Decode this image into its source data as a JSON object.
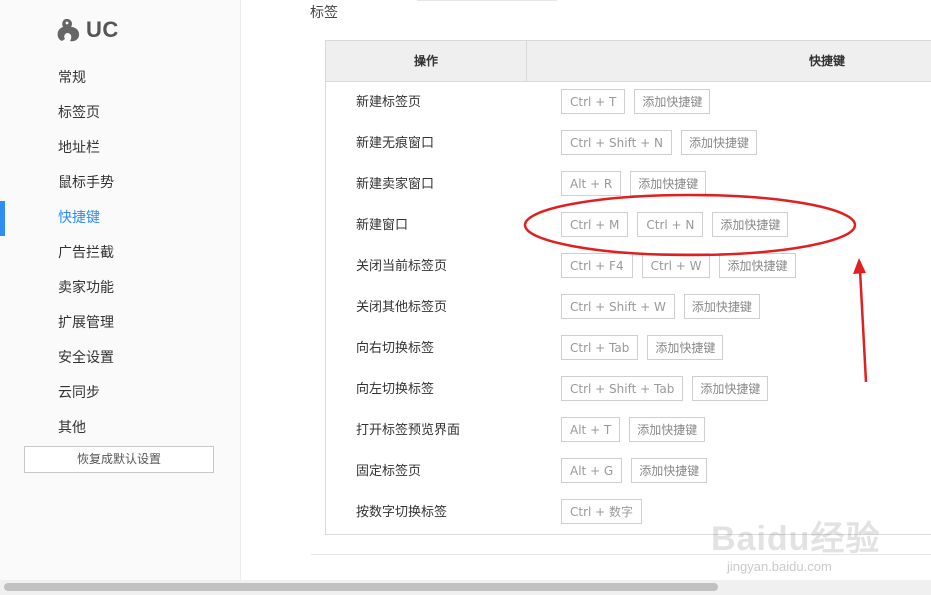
{
  "sidebar": {
    "logo_text": "UC",
    "items": [
      {
        "label": "常规"
      },
      {
        "label": "标签页"
      },
      {
        "label": "地址栏"
      },
      {
        "label": "鼠标手势"
      },
      {
        "label": "快捷键"
      },
      {
        "label": "广告拦截"
      },
      {
        "label": "卖家功能"
      },
      {
        "label": "扩展管理"
      },
      {
        "label": "安全设置"
      },
      {
        "label": "云同步"
      },
      {
        "label": "其他"
      }
    ],
    "active_item": "快捷键",
    "restore_label": "恢复成默认设置"
  },
  "main": {
    "section_label": "标签",
    "table": {
      "col_action": "操作",
      "col_shortcut": "快捷键",
      "add_label": "添加快捷键",
      "rows": [
        {
          "action": "新建标签页",
          "keys": [
            "Ctrl + T"
          ],
          "add": true
        },
        {
          "action": "新建无痕窗口",
          "keys": [
            "Ctrl + Shift + N"
          ],
          "add": true
        },
        {
          "action": "新建卖家窗口",
          "keys": [
            "Alt + R"
          ],
          "add": true
        },
        {
          "action": "新建窗口",
          "keys": [
            "Ctrl + M",
            "Ctrl + N"
          ],
          "add": true
        },
        {
          "action": "关闭当前标签页",
          "keys": [
            "Ctrl + F4",
            "Ctrl + W"
          ],
          "add": true
        },
        {
          "action": "关闭其他标签页",
          "keys": [
            "Ctrl + Shift + W"
          ],
          "add": true
        },
        {
          "action": "向右切换标签",
          "keys": [
            "Ctrl + Tab"
          ],
          "add": true
        },
        {
          "action": "向左切换标签",
          "keys": [
            "Ctrl + Shift + Tab"
          ],
          "add": true
        },
        {
          "action": "打开标签预览界面",
          "keys": [
            "Alt + T"
          ],
          "add": true
        },
        {
          "action": "固定标签页",
          "keys": [
            "Alt + G"
          ],
          "add": true
        },
        {
          "action": "按数字切换标签",
          "keys": [
            "Ctrl + 数字"
          ],
          "add": false
        }
      ]
    }
  },
  "watermark": {
    "brand": "Baidu经验",
    "url": "jingyan.baidu.com"
  },
  "colors": {
    "accent": "#2f8cf0",
    "annotation": "#e02020"
  }
}
